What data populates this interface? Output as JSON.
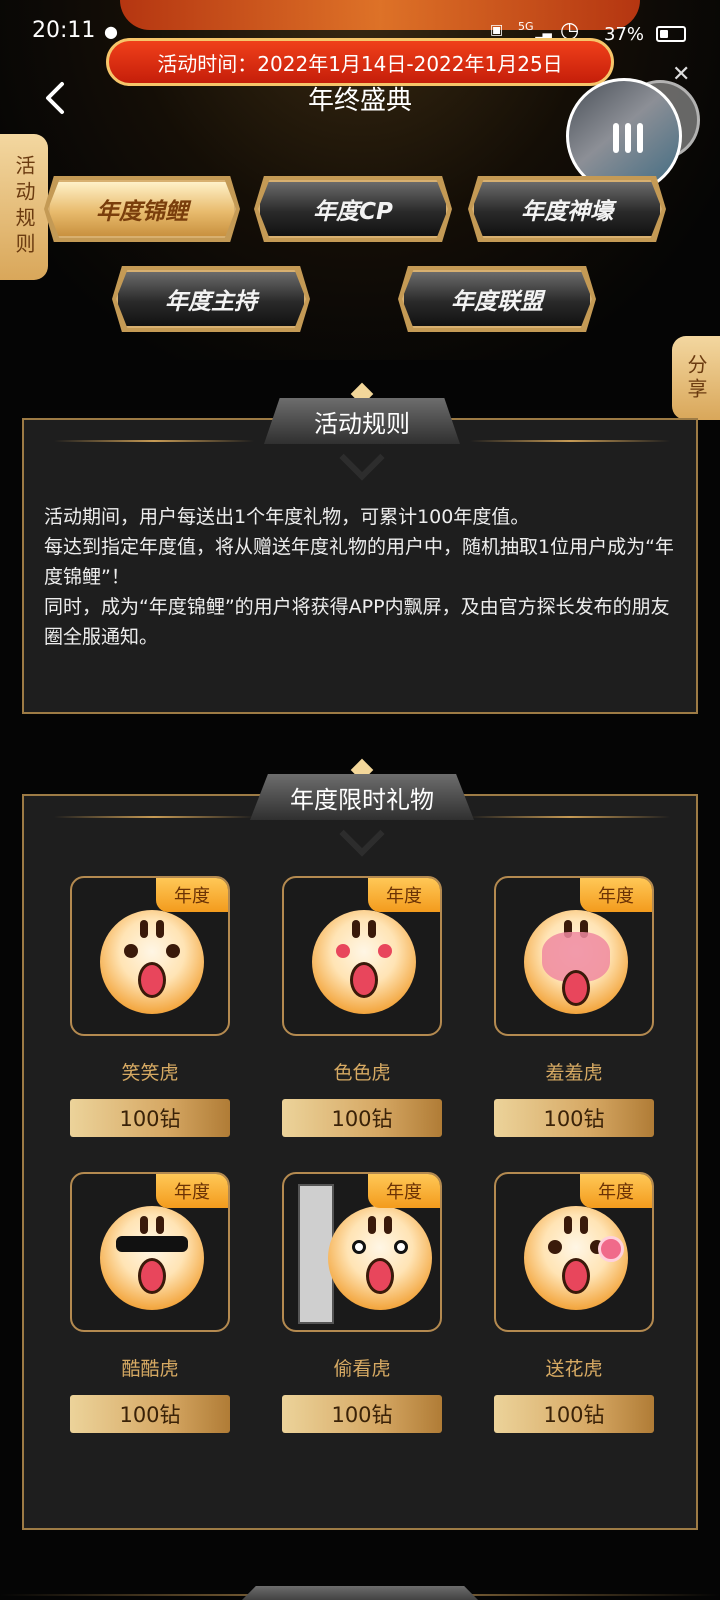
{
  "status_bar": {
    "time": "20:11",
    "network": "5G",
    "battery": "37%",
    "battery_level": 0.37
  },
  "header": {
    "date_banner": "活动时间：2022年1月14日-2022年1月25日",
    "title": "年终盛典",
    "back_icon": "chevron-left-icon",
    "close_icon": "close-icon"
  },
  "side_buttons": {
    "rules": "活动规则",
    "share": "分享"
  },
  "tabs": [
    {
      "label": "年度锦鲤",
      "active": true
    },
    {
      "label": "年度CP",
      "active": false
    },
    {
      "label": "年度神壕",
      "active": false
    },
    {
      "label": "年度主持",
      "active": false
    },
    {
      "label": "年度联盟",
      "active": false
    }
  ],
  "rules_panel": {
    "title": "活动规则",
    "lines": [
      "活动期间，用户每送出1个年度礼物，可累计100年度值。",
      "每达到指定年度值，将从赠送年度礼物的用户中，随机抽取1位用户成为“年度锦鲤”！",
      "同时，成为“年度锦鲤”的用户将获得APP内飘屏，及由官方探长发布的朋友圈全服通知。"
    ]
  },
  "gifts_panel": {
    "title": "年度限时礼物",
    "badge": "年度",
    "items": [
      {
        "name": "笑笑虎",
        "price": "100钻"
      },
      {
        "name": "色色虎",
        "price": "100钻"
      },
      {
        "name": "羞羞虎",
        "price": "100钻"
      },
      {
        "name": "酷酷虎",
        "price": "100钻"
      },
      {
        "name": "偷看虎",
        "price": "100钻"
      },
      {
        "name": "送花虎",
        "price": "100钻"
      }
    ]
  },
  "colors": {
    "gold": "#d7aa63",
    "banner_red": "#e0301a",
    "panel_bg": "#1e1e1e"
  }
}
